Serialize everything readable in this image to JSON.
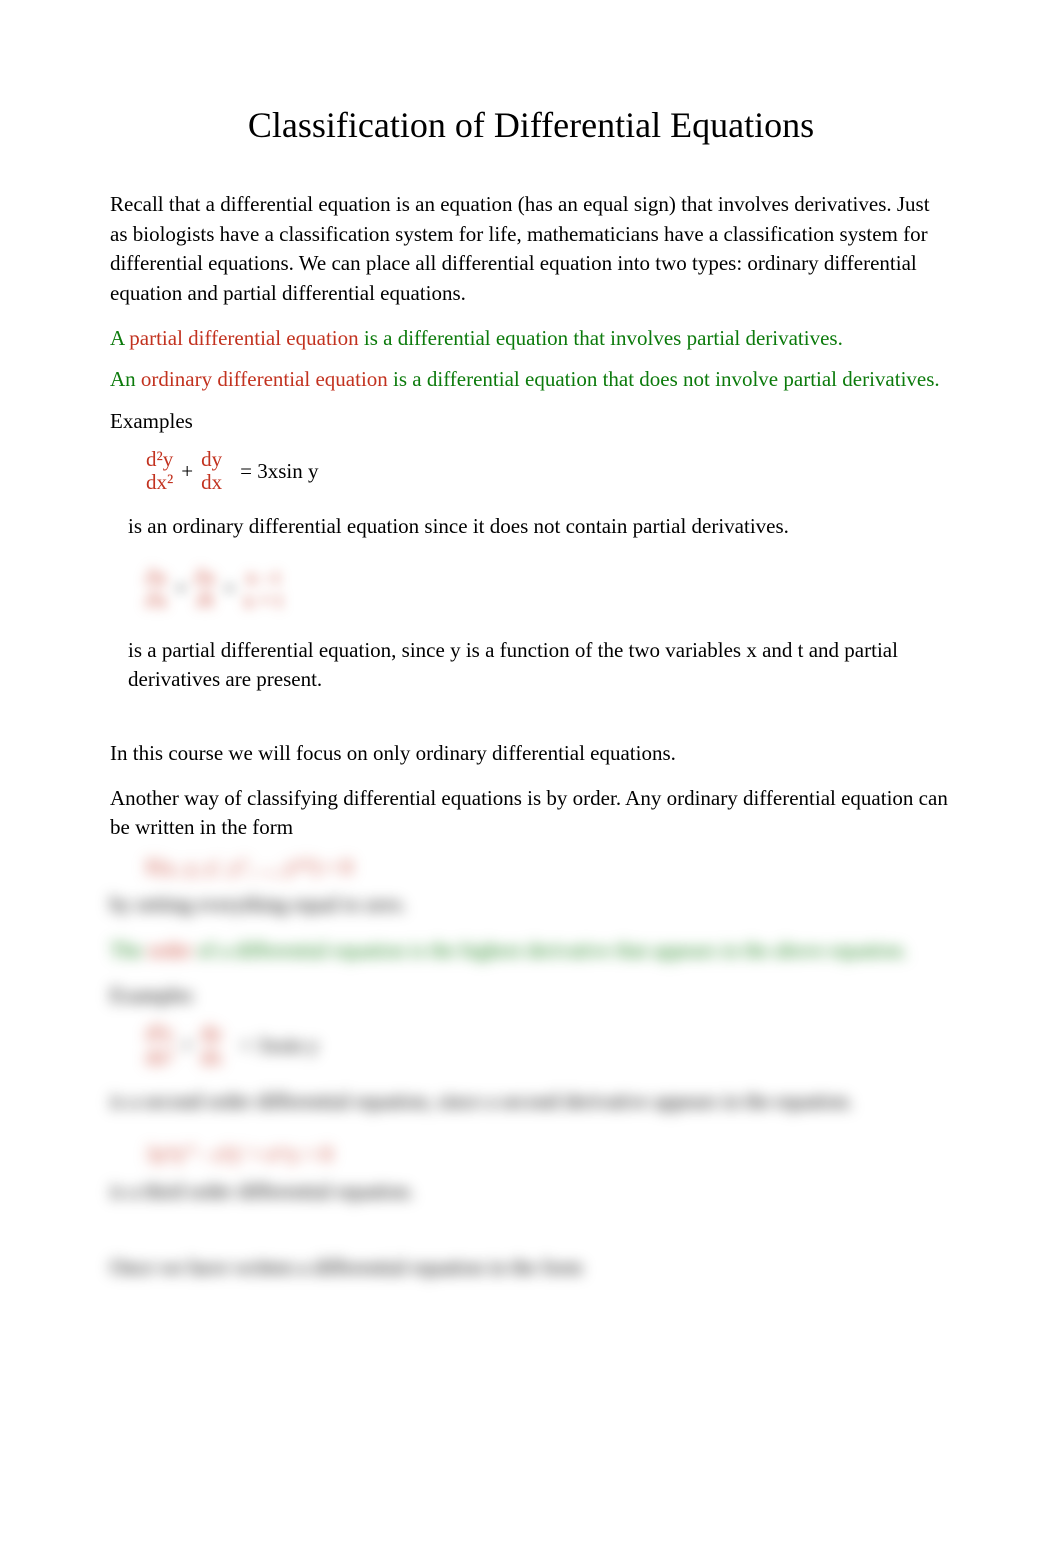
{
  "title": "Classification of Differential Equations",
  "intro": "Recall that a differential equation is an equation (has an equal sign) that involves derivatives. Just as biologists have a classification system for life, mathematicians have a classification system for differential equations. We can place all differential equation into two types: ordinary differential equation and partial differential equations.",
  "def_partial": {
    "prefix": "A ",
    "term": "partial differential equation",
    "rest": " is a differential equation that involves partial derivatives."
  },
  "def_ordinary": {
    "prefix": "An ",
    "term": "ordinary differential equation",
    "rest": " is a differential equation that does not involve partial derivatives."
  },
  "examples_label": "Examples",
  "eq1": {
    "frac1_top": "d²y",
    "frac1_bot": "dx²",
    "frac2_top": "dy",
    "frac2_bot": "dx",
    "plus": "  +  ",
    "rhs": "=  3xsin y"
  },
  "eq1_explain": "is an ordinary differential equation since it does not contain partial derivatives.",
  "eq2": {
    "frac1_top": "∂y",
    "frac1_bot": "∂x",
    "frac2_top": "∂y",
    "frac2_bot": "∂t",
    "frac3_top": "x - t",
    "frac3_bot": "x + t",
    "plus": "  +  ",
    "equals": "  =  "
  },
  "eq2_explain": "is a partial differential equation, since y is a function of the two variables x and t and partial derivatives are present.",
  "ode_focus": "In this course we will focus on only ordinary differential equations.",
  "order_intro": "Another way of classifying differential equations is by order. Any ordinary differential equation can be written in the form",
  "order_form": "F(x, y, y', y'', ..., y⁽ⁿ⁾) = 0",
  "order_setzero": "by setting everything equal to zero.",
  "order_def": {
    "the": "The ",
    "term": "order",
    "rest": " of a differential equation is the highest derivative that appears in the above equation."
  },
  "examples_label2": "Examples",
  "eq3": {
    "frac1_top": "d²y",
    "frac1_bot": "dx²",
    "frac2_top": "dy",
    "frac2_bot": "dx",
    "plus": "  +  ",
    "rhs": "=  3xsin y"
  },
  "eq3_explain": "is a second order differential equation, since a second derivative appears in the equation.",
  "eq4": "3y⁴y''' - x³y' + eˣʸy = 0",
  "eq4_explain": "is a third order differential equation.",
  "written_form": "Once we have written a differential equation in the form"
}
